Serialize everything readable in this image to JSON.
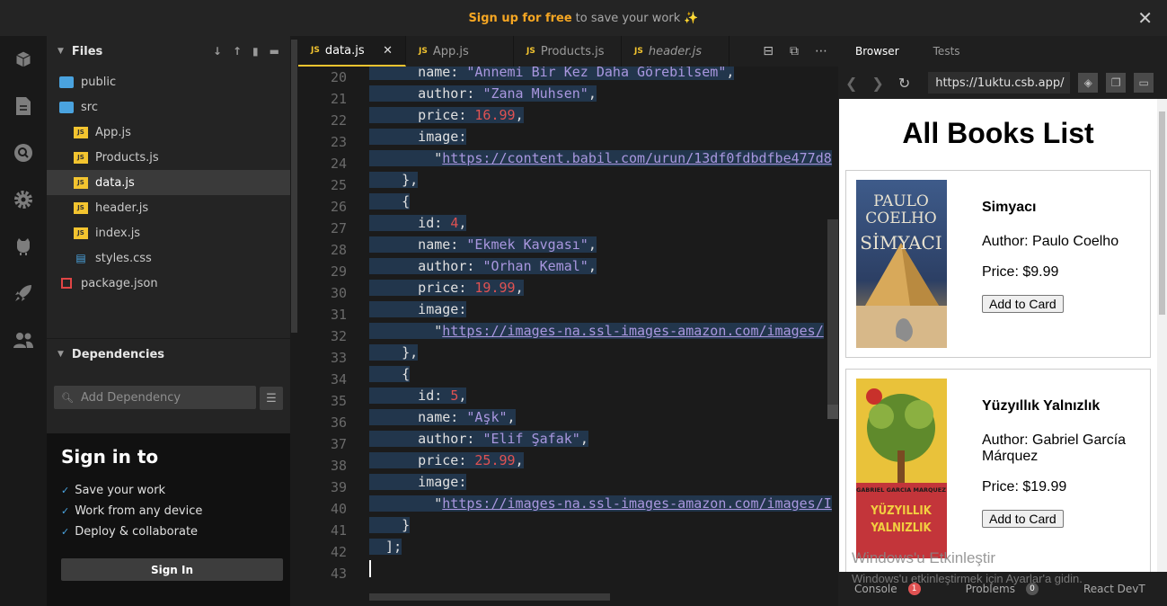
{
  "topbar": {
    "signup": "Sign up for free",
    "rest": "to save your work ✨"
  },
  "rail": [
    "cube-icon",
    "file-icon",
    "search-icon",
    "gear-icon",
    "github-icon",
    "rocket-icon",
    "users-icon"
  ],
  "files": {
    "title": "Files",
    "items": [
      {
        "label": "public",
        "type": "folder",
        "indent": 0
      },
      {
        "label": "src",
        "type": "folder-open",
        "indent": 0
      },
      {
        "label": "App.js",
        "type": "js",
        "indent": 1
      },
      {
        "label": "Products.js",
        "type": "js",
        "indent": 1
      },
      {
        "label": "data.js",
        "type": "js",
        "indent": 1,
        "selected": true
      },
      {
        "label": "header.js",
        "type": "js",
        "indent": 1
      },
      {
        "label": "index.js",
        "type": "js",
        "indent": 1
      },
      {
        "label": "styles.css",
        "type": "css",
        "indent": 1
      },
      {
        "label": "package.json",
        "type": "pkg",
        "indent": 0
      }
    ]
  },
  "deps": {
    "title": "Dependencies",
    "placeholder": "Add Dependency"
  },
  "signin": {
    "title": "Sign in to",
    "items": [
      "Save your work",
      "Work from any device",
      "Deploy & collaborate"
    ],
    "button": "Sign In"
  },
  "tabs": [
    {
      "label": "data.js",
      "active": true
    },
    {
      "label": "App.js",
      "active": false
    },
    {
      "label": "Products.js",
      "active": false
    },
    {
      "label": "header.js",
      "active": false
    }
  ],
  "editor": {
    "line_numbers": [
      "20",
      "21",
      "22",
      "23",
      "24",
      "25",
      "26",
      "27",
      "28",
      "29",
      "30",
      "31",
      "32",
      "33",
      "34",
      "35",
      "36",
      "37",
      "38",
      "39",
      "40",
      "41",
      "42",
      "43"
    ],
    "lines": [
      [
        {
          "c": "k",
          "t": "      name: "
        },
        {
          "c": "s",
          "t": "\"Annemi Bir Kez Daha Görebilsem\""
        },
        {
          "c": "k",
          "t": ","
        }
      ],
      [
        {
          "c": "k",
          "t": "      author: "
        },
        {
          "c": "s",
          "t": "\"Zana Muhsen\""
        },
        {
          "c": "k",
          "t": ","
        }
      ],
      [
        {
          "c": "k",
          "t": "      price: "
        },
        {
          "c": "n",
          "t": "16.99"
        },
        {
          "c": "k",
          "t": ","
        }
      ],
      [
        {
          "c": "k",
          "t": "      image:"
        }
      ],
      [
        {
          "c": "k",
          "t": "        \""
        },
        {
          "c": "u",
          "t": "https://content.babil.com/urun/13df0fdbdfbe477d8"
        }
      ],
      [
        {
          "c": "k",
          "t": "    },"
        }
      ],
      [
        {
          "c": "k",
          "t": "    {"
        }
      ],
      [
        {
          "c": "k",
          "t": "      id: "
        },
        {
          "c": "n",
          "t": "4"
        },
        {
          "c": "k",
          "t": ","
        }
      ],
      [
        {
          "c": "k",
          "t": "      name: "
        },
        {
          "c": "s",
          "t": "\"Ekmek Kavgası\""
        },
        {
          "c": "k",
          "t": ","
        }
      ],
      [
        {
          "c": "k",
          "t": "      author: "
        },
        {
          "c": "s",
          "t": "\"Orhan Kemal\""
        },
        {
          "c": "k",
          "t": ","
        }
      ],
      [
        {
          "c": "k",
          "t": "      price: "
        },
        {
          "c": "n",
          "t": "19.99"
        },
        {
          "c": "k",
          "t": ","
        }
      ],
      [
        {
          "c": "k",
          "t": "      image:"
        }
      ],
      [
        {
          "c": "k",
          "t": "        \""
        },
        {
          "c": "u",
          "t": "https://images-na.ssl-images-amazon.com/images/"
        }
      ],
      [
        {
          "c": "k",
          "t": "    },"
        }
      ],
      [
        {
          "c": "k",
          "t": "    {"
        }
      ],
      [
        {
          "c": "k",
          "t": "      id: "
        },
        {
          "c": "n",
          "t": "5"
        },
        {
          "c": "k",
          "t": ","
        }
      ],
      [
        {
          "c": "k",
          "t": "      name: "
        },
        {
          "c": "s",
          "t": "\"Aşk\""
        },
        {
          "c": "k",
          "t": ","
        }
      ],
      [
        {
          "c": "k",
          "t": "      author: "
        },
        {
          "c": "s",
          "t": "\"Elif Şafak\""
        },
        {
          "c": "k",
          "t": ","
        }
      ],
      [
        {
          "c": "k",
          "t": "      price: "
        },
        {
          "c": "n",
          "t": "25.99"
        },
        {
          "c": "k",
          "t": ","
        }
      ],
      [
        {
          "c": "k",
          "t": "      image:"
        }
      ],
      [
        {
          "c": "k",
          "t": "        \""
        },
        {
          "c": "u",
          "t": "https://images-na.ssl-images-amazon.com/images/I"
        }
      ],
      [
        {
          "c": "k",
          "t": "    }"
        }
      ],
      [
        {
          "c": "k",
          "t": "  ];"
        }
      ],
      []
    ]
  },
  "browser": {
    "tabs": [
      "Browser",
      "Tests"
    ],
    "url": "https://1uktu.csb.app/",
    "page": {
      "title": "All Books List",
      "books": [
        {
          "title": "Simyacı",
          "author": "Author: Paulo Coelho",
          "price": "Price: $9.99",
          "button": "Add to Card",
          "cover_top": "PAULO",
          "cover_mid": "COELHO",
          "cover_big": "SİMYACI"
        },
        {
          "title": "Yüzyıllık Yalnızlık",
          "author": "Author: Gabriel García Márquez",
          "price": "Price: $19.99",
          "button": "Add to Card",
          "cover_top": "GABRIEL GARCIA MARQUEZ",
          "cover_mid": "YÜZYILLIK",
          "cover_big": "YALNIZLIK"
        }
      ]
    },
    "bottom": {
      "console": "Console",
      "console_count": "1",
      "problems": "Problems",
      "problems_count": "0",
      "devtools": "React DevT"
    }
  },
  "watermark": {
    "line1": "Windows'u Etkinleştir",
    "line2": "Windows'u etkinleştirmek için Ayarlar'a gidin."
  },
  "colors": {
    "accent": "#f3c42f",
    "signup": "#f5a623",
    "string": "#a997df",
    "number": "#e05252",
    "selection": "#22364c"
  }
}
